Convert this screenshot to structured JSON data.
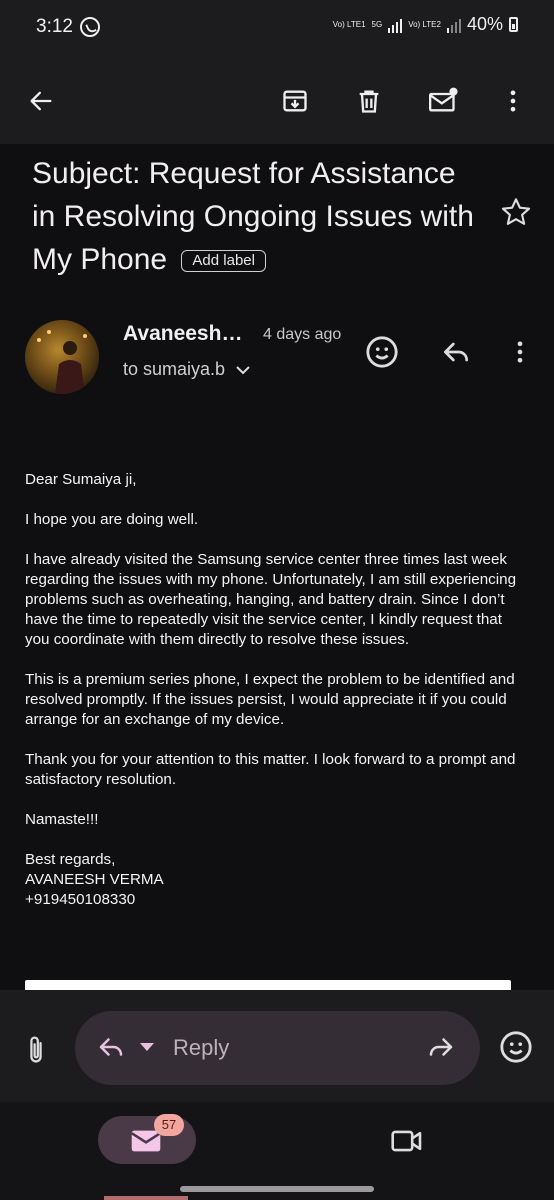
{
  "status": {
    "time": "3:12",
    "network1": "Vo) LTE1",
    "net5g": "5G",
    "network2": "Vo) LTE2",
    "battery": "40%"
  },
  "toolbar": {
    "back": "back-arrow-icon",
    "archive": "archive-icon",
    "delete": "trash-icon",
    "mark_unread": "mark-unread-icon",
    "more": "more-vert-icon"
  },
  "email": {
    "subject": "Subject: Request for Assistance in Resolving Ongoing Issues with My Phone",
    "add_label": "Add label",
    "sender": "Avaneesh…",
    "time_ago": "4 days ago",
    "to": "to sumaiya.b",
    "body": [
      "Dear Sumaiya ji,",
      "I hope you are doing well.",
      "I have already visited the Samsung service center three times last week regarding the issues with my phone. Unfortunately, I am still experiencing problems such as overheating, hanging, and battery drain. Since I don’t have the time to repeatedly visit the service center, I kindly request that you coordinate with them directly to resolve these issues.",
      "This is a premium series phone, I expect the problem to be identified and resolved promptly. If the issues persist, I would appreciate it if you could arrange for an exchange of my device.",
      "Thank you for your attention to this matter. I look forward to a prompt and satisfactory resolution.",
      "Namaste!!!"
    ],
    "signature": [
      "Best regards,",
      "AVANEESH VERMA",
      "+919450108330"
    ]
  },
  "reply_bar": {
    "placeholder": "Reply"
  },
  "nav": {
    "mail_badge": "57"
  },
  "colors": {
    "background": "#0f0e10",
    "bar": "#1c1b1d",
    "accent_pink": "#e8c1e0",
    "badge": "#f2a6a0"
  }
}
